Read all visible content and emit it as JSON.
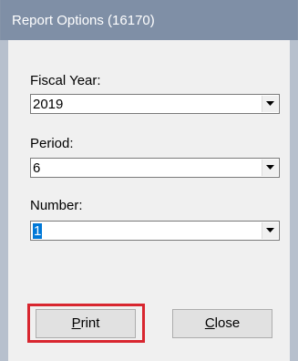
{
  "window": {
    "title": "Report Options (16170)"
  },
  "fields": {
    "fiscal_year": {
      "label": "Fiscal Year:",
      "value": "2019"
    },
    "period": {
      "label": "Period:",
      "value": "6"
    },
    "number": {
      "label": "Number:",
      "value": "1"
    }
  },
  "buttons": {
    "print": {
      "mnemonic": "P",
      "rest": "rint"
    },
    "close": {
      "mnemonic": "C",
      "rest": "lose"
    }
  },
  "colors": {
    "titlebar": "#7f8fa6",
    "frame": "#b7c0cd",
    "highlight_outline": "#d8262f",
    "selection": "#0078d7"
  },
  "icons": {
    "dropdown": "chevron-down-icon"
  }
}
